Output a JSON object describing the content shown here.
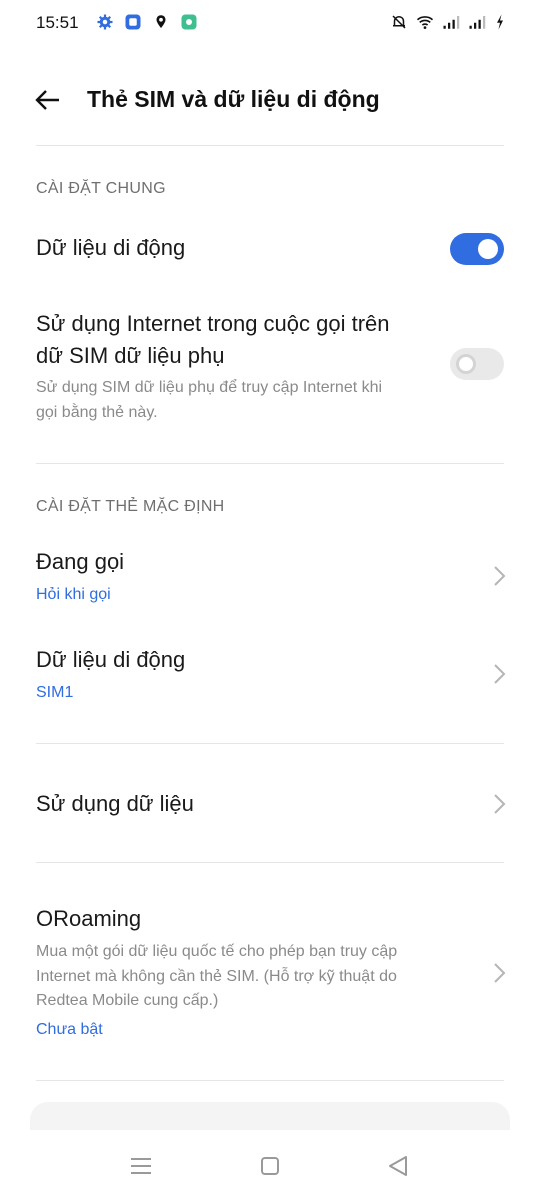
{
  "status_bar": {
    "time": "15:51",
    "left_icons": [
      "gear-icon",
      "app-square-icon",
      "location-pin-icon",
      "app-badge-icon"
    ],
    "right_icons": [
      "bell-off-icon",
      "wifi-icon",
      "signal-icon",
      "signal-icon",
      "charging-icon"
    ]
  },
  "header": {
    "title": "Thẻ SIM và dữ liệu di động"
  },
  "general": {
    "section_title": "CÀI ĐẶT CHUNG",
    "mobile_data": {
      "title": "Dữ liệu di động",
      "enabled": true
    },
    "secondary_sim_internet": {
      "title_line1": "Sử dụng Internet trong cuộc gọi trên",
      "title_line2": "dữ SIM dữ liệu phụ",
      "subtitle_line1": "Sử dụng SIM dữ liệu phụ để truy cập Internet khi",
      "subtitle_line2": "gọi bằng thẻ này.",
      "enabled": false
    }
  },
  "default_sim": {
    "section_title": "CÀI ĐẶT THẺ MẶC ĐỊNH",
    "calling": {
      "title": "Đang gọi",
      "value": "Hỏi khi gọi"
    },
    "mobile_data": {
      "title": "Dữ liệu di động",
      "value": "SIM1"
    }
  },
  "data_usage": {
    "title": "Sử dụng dữ liệu"
  },
  "oroaming": {
    "title": "ORoaming",
    "desc_line1": "Mua một gói dữ liệu quốc tế cho phép bạn truy cập",
    "desc_line2": "Internet mà không cần thẻ SIM. (Hỗ trợ kỹ thuật do",
    "desc_line3": "Redtea Mobile cung cấp.)",
    "status": "Chưa bật"
  },
  "colors": {
    "accent": "#2f6de0",
    "toggle_off": "#e9e9e9",
    "secondary_text": "#8a8a8a"
  }
}
